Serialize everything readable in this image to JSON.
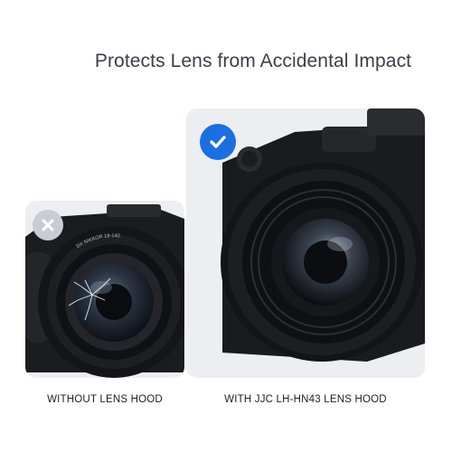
{
  "headline": "Protects Lens from Accidental Impact",
  "panels": [
    {
      "caption": "WITHOUT LENS HOOD",
      "status": "negative",
      "badge_icon": "x-icon",
      "lens_markings": "DX NIKKOR 18-140"
    },
    {
      "caption": "WITH JJC LH-HN43 LENS HOOD",
      "status": "positive",
      "badge_icon": "check-icon"
    }
  ],
  "colors": {
    "headline": "#3a3f4a",
    "panel_background": "#eceef2",
    "check_badge": "#1b6fe0",
    "x_badge": "#c9ccd2"
  }
}
